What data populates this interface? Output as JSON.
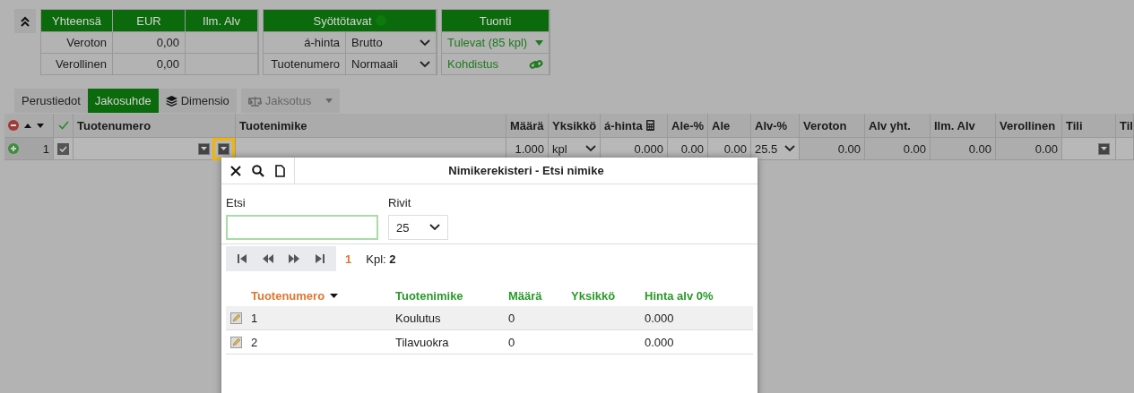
{
  "totals": {
    "columns": [
      "Yhteensä",
      "EUR",
      "Ilm. Alv"
    ],
    "rows": [
      {
        "label": "Veroton",
        "eur": "0,00"
      },
      {
        "label": "Verollinen",
        "eur": "0,00"
      }
    ]
  },
  "input_modes": {
    "title": "Syöttötavat",
    "rows": [
      {
        "label": "á-hinta",
        "value": "Brutto"
      },
      {
        "label": "Tuotenumero",
        "value": "Normaali"
      }
    ]
  },
  "import": {
    "title": "Tuonti",
    "items": [
      {
        "kind": "dropdown",
        "label": "Tulevat (85 kpl)"
      },
      {
        "kind": "link",
        "label": "Kohdistus"
      }
    ]
  },
  "tabs": [
    {
      "label": "Perustiedot",
      "selected": false,
      "disabled": false
    },
    {
      "label": "Jakosuhde",
      "selected": true,
      "disabled": false
    },
    {
      "label": "Dimensio",
      "selected": false,
      "disabled": false
    },
    {
      "label": "Jaksotus",
      "selected": false,
      "disabled": true
    }
  ],
  "grid": {
    "columns": [
      "Tuotenumero",
      "Tuotenimike",
      "Määrä",
      "Yksikkö",
      "á-hinta",
      "Ale-%",
      "Ale",
      "Alv-%",
      "Veroton",
      "Alv yht.",
      "Ilm. Alv",
      "Verollinen",
      "Tili",
      "Til"
    ],
    "rows": [
      {
        "number": "1",
        "checked": true,
        "cells": [
          {
            "kind": "lookup",
            "highlighted": true
          },
          {
            "kind": "empty"
          },
          {
            "kind": "text",
            "value": "1.000"
          },
          {
            "kind": "select",
            "value": "kpl"
          },
          {
            "kind": "text",
            "value": "0.000"
          },
          {
            "kind": "text",
            "value": "0.00"
          },
          {
            "kind": "text",
            "value": "0.00"
          },
          {
            "kind": "select",
            "value": "25.5"
          },
          {
            "kind": "readonly",
            "value": "0.00"
          },
          {
            "kind": "readonly",
            "value": "0.00"
          },
          {
            "kind": "readonly",
            "value": "0.00"
          },
          {
            "kind": "readonly",
            "value": "0.00"
          },
          {
            "kind": "button"
          },
          {
            "kind": "empty"
          }
        ]
      }
    ]
  },
  "dialog": {
    "title": "Nimikerekisteri - Etsi nimike",
    "search_label": "Etsi",
    "rows_label": "Rivit",
    "rows_value": "25",
    "page": "1",
    "count": "Kpl: **2**",
    "columns": [
      {
        "label": "Tuotenumero",
        "sorted": true
      },
      {
        "label": "Tuotenimike",
        "sorted": false
      },
      {
        "label": "Määrä",
        "sorted": false
      },
      {
        "label": "Yksikkö",
        "sorted": false
      },
      {
        "label": "Hinta alv 0%",
        "sorted": false
      }
    ],
    "rows": [
      {
        "cells": [
          "1",
          "Koulutus",
          "0",
          "",
          "0.000"
        ]
      },
      {
        "cells": [
          "2",
          "Tilavuokra",
          "0",
          "",
          "0.000"
        ]
      }
    ]
  }
}
